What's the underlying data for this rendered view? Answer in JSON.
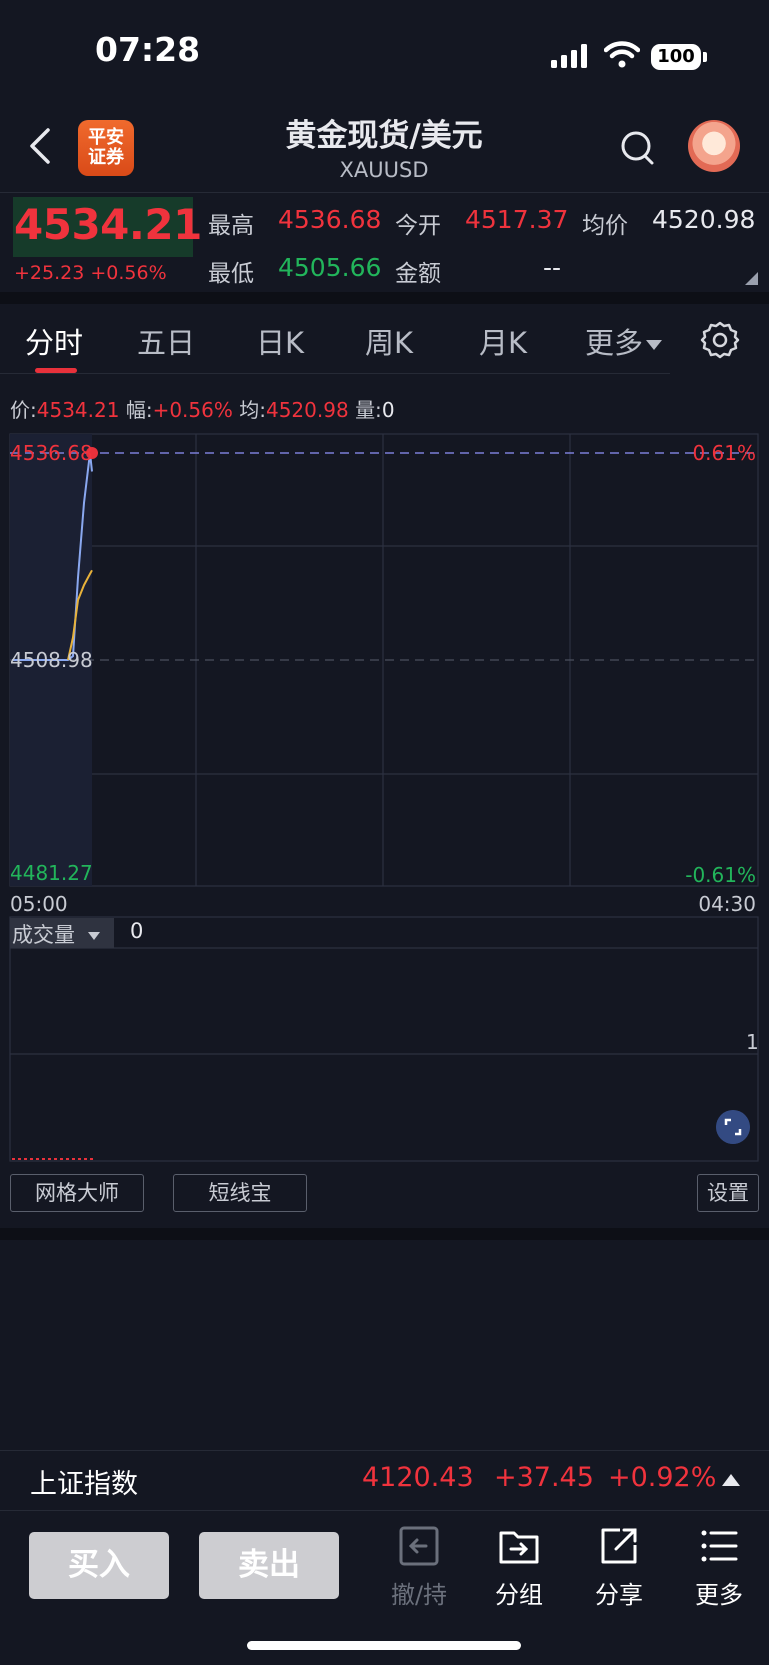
{
  "status_bar": {
    "time": "07:28",
    "battery": "100"
  },
  "header": {
    "logo_line1": "平安",
    "logo_line2": "证券",
    "title": "黄金现货/美元",
    "subtitle": "XAUUSD"
  },
  "quote": {
    "last_price": "4534.21",
    "change": "+25.23 +0.56%",
    "high_label": "最高",
    "high": "4536.68",
    "open_label": "今开",
    "open": "4517.37",
    "avg_label": "均价",
    "avg": "4520.98",
    "low_label": "最低",
    "low": "4505.66",
    "amount_label": "金额",
    "amount": "--"
  },
  "tabs": [
    "分时",
    "五日",
    "日K",
    "周K",
    "月K",
    "更多"
  ],
  "info_line": {
    "price_label": "价:",
    "price": "4534.21",
    "range_label": "幅:",
    "range": "+0.56%",
    "avg_label": "均:",
    "avg": "4520.98",
    "vol_label": "量:",
    "vol": "0"
  },
  "chart_data": {
    "type": "line",
    "y_top": "4536.68",
    "y_mid": "4508.98",
    "y_bottom": "4481.27",
    "pct_top": "0.61%",
    "pct_bottom": "-0.61%",
    "x_start": "05:00",
    "x_end": "04:30",
    "ylim": [
      4481.27,
      4536.68
    ],
    "series": [
      {
        "values": [
          4508.98,
          4508.98,
          4509.5,
          4520.0,
          4530.0,
          4536.68,
          4534.21
        ]
      },
      {
        "values": [
          4508.98,
          4508.98,
          4512.0,
          4517.0,
          4519.0,
          4520.5,
          4520.98
        ]
      }
    ]
  },
  "volume": {
    "label": "成交量",
    "value": "0",
    "scale_max": "1"
  },
  "tools": {
    "grid_master": "网格大师",
    "short_line": "短线宝",
    "settings": "设置"
  },
  "ticker": {
    "name": "上证指数",
    "value": "4120.43",
    "change": "+37.45",
    "percent": "+0.92%"
  },
  "bottom_bar": {
    "buy": "买入",
    "sell": "卖出",
    "cancel_hold": "撤/持",
    "group": "分组",
    "share": "分享",
    "more": "更多"
  },
  "colors": {
    "up": "#f0333d",
    "down": "#22b55b",
    "price_line": "#8aa8f0",
    "avg_line": "#e8b23a"
  }
}
